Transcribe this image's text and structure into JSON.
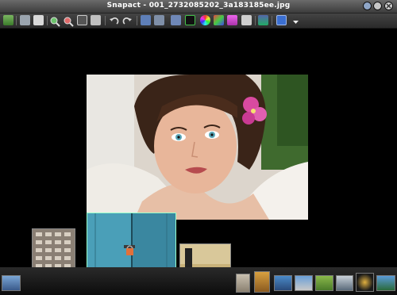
{
  "window": {
    "title": "Snapact - 001_2732085202_3a183185ee.jpg"
  },
  "toolbar": {
    "icons": [
      "open-folder-icon",
      "thumbnails-icon",
      "print-icon",
      "zoom-in-icon",
      "zoom-out-icon",
      "fit-to-window-icon",
      "actual-size-icon",
      "rotate-left-icon",
      "rotate-right-icon",
      "slideshow-icon",
      "gallery-icon",
      "edit-icon",
      "crop-icon",
      "color-wheel-icon",
      "effects-icon",
      "enhance-icon",
      "info-icon",
      "screen-capture-icon",
      "help-icon",
      "more-dropdown-icon"
    ]
  },
  "colors": {
    "accent": "#3b6fd1",
    "background": "#000000",
    "titlebar": "#4a4a4a"
  }
}
